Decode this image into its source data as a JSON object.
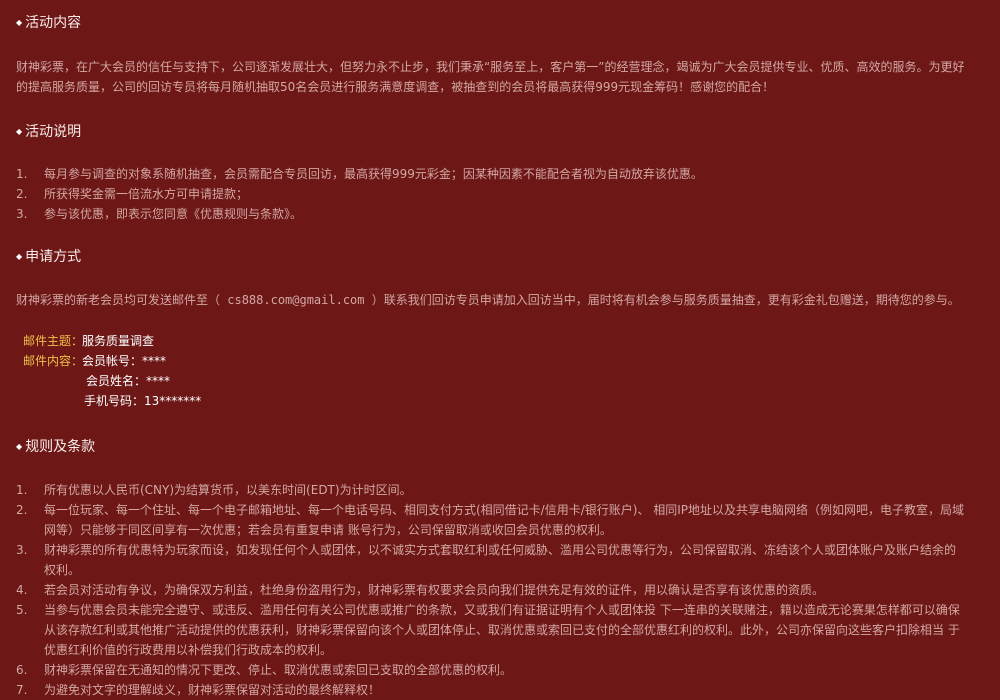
{
  "sections": {
    "activity_content": {
      "title": "活动内容",
      "paragraph": "财神彩票，在广大会员的信任与支持下，公司逐渐发展壮大，但努力永不止步，我们秉承“服务至上，客户第一”的经营理念，竭诚为广大会员提供专业、优质、高效的服务。为更好的提高服务质量，公司的回访专员将每月随机抽取50名会员进行服务满意度调查，被抽查到的会员将最高获得999元现金筹码！感谢您的配合！"
    },
    "activity_description": {
      "title": "活动说明",
      "items": [
        {
          "num": "1.",
          "text": "每月参与调查的对象系随机抽查，会员需配合专员回访，最高获得999元彩金；因某种因素不能配合者视为自动放弃该优惠。"
        },
        {
          "num": "2.",
          "text": "所获得奖金需一倍流水方可申请提款；"
        },
        {
          "num": "3.",
          "text": "参与该优惠，即表示您同意《优惠规则与条款》。"
        }
      ]
    },
    "application": {
      "title": "申请方式",
      "paragraph_prefix": "财神彩票的新老会员均可发送邮件至（",
      "email": " cs888.com@gmail.com ",
      "paragraph_suffix": "）联系我们回访专员申请加入回访当中，届时将有机会参与服务质量抽查，更有彩金礼包赠送，期待您的参与。",
      "mail_subject_key": "邮件主题：",
      "mail_subject_value": "服务质量调查",
      "mail_content_key": "邮件内容：",
      "mail_lines": [
        "会员帐号：****",
        "会员姓名：****",
        "手机号码：13*******"
      ]
    },
    "rules": {
      "title": "规则及条款",
      "items": [
        {
          "num": "1.",
          "text": "所有优惠以人民币(CNY)为结算货币，以美东时间(EDT)为计时区间。"
        },
        {
          "num": "2.",
          "text": "每一位玩家、每一个住址、每一个电子邮箱地址、每一个电话号码、相同支付方式(相同借记卡/信用卡/银行账户)、 相同IP地址以及共享电脑网络（例如网吧，电子教室，局域网等）只能够于同区间享有一次优惠；若会员有重复申请 账号行为，公司保留取消或收回会员优惠的权利。"
        },
        {
          "num": "3.",
          "text": "财神彩票的所有优惠特为玩家而设，如发现任何个人或团体，以不诚实方式套取红利或任何威胁、滥用公司优惠等行为，公司保留取消、冻结该个人或团体账户及账户结余的权利。"
        },
        {
          "num": "4.",
          "text": "若会员对活动有争议，为确保双方利益，杜绝身份盗用行为，财神彩票有权要求会员向我们提供充足有效的证件，用以确认是否享有该优惠的资质。"
        },
        {
          "num": "5.",
          "text": "当参与优惠会员未能完全遵守、或违反、滥用任何有关公司优惠或推广的条款，又或我们有证据证明有个人或团体投 下一连串的关联赌注，籍以造成无论赛果怎样都可以确保从该存款红利或其他推广活动提供的优惠获利，财神彩票保留向该个人或团体停止、取消优惠或索回已支付的全部优惠红利的权利。此外，公司亦保留向这些客户扣除相当 于优惠红利价值的行政费用以补偿我们行政成本的权利。"
        },
        {
          "num": "6.",
          "text": "财神彩票保留在无通知的情况下更改、停止、取消优惠或索回已支取的全部优惠的权利。"
        },
        {
          "num": "7.",
          "text": "为避免对文字的理解歧义，财神彩票保留对活动的最终解释权！"
        }
      ]
    }
  }
}
